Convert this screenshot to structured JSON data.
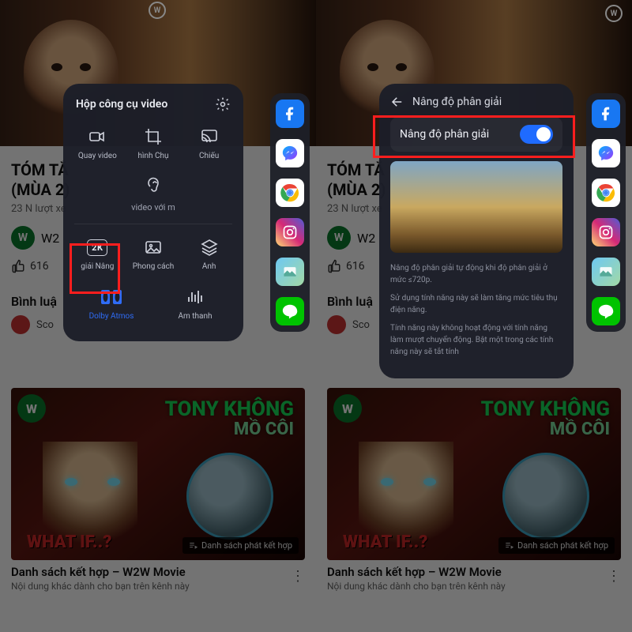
{
  "studio_badge": "W",
  "video": {
    "title_line1": "TÓM TẮ",
    "title_line2": "(MÙA 2)",
    "views": "23 N lượt xe",
    "channel_initial": "W",
    "channel_name": "W2",
    "like_count": "616",
    "comments_label": "Bình luậ",
    "commenter_name": "Sco"
  },
  "card": {
    "badge": "W",
    "headline_top": "TONY KHÔNG",
    "headline_bottom": "MỒ CÔI",
    "whatif": "WHAT IF..?",
    "playlist_tag": "Danh sách phát kết hợp",
    "title": "Danh sách kết hợp – W2W Movie",
    "subtitle": "Nội dung khác dành cho bạn trên kênh này"
  },
  "sidebar_apps": [
    "facebook",
    "messenger",
    "chrome",
    "instagram",
    "gallery",
    "line"
  ],
  "toolbox": {
    "title": "Hộp công cụ video",
    "tools_row1": [
      {
        "icon": "camcorder",
        "label": "Quay video"
      },
      {
        "icon": "crop",
        "label": "hình   Chụ"
      },
      {
        "icon": "cast",
        "label": "Chiếu"
      }
    ],
    "tools_row2_label": "video với m",
    "tools_row3": [
      {
        "icon": "2k",
        "label": "giải    Nâng"
      },
      {
        "icon": "image",
        "label": "Phong cách"
      },
      {
        "icon": "layers",
        "label": "Ảnh"
      }
    ],
    "tools_row4": [
      {
        "icon": "dolby",
        "label": "Dolby Atmos"
      },
      {
        "icon": "equalizer",
        "label": "Âm thanh"
      }
    ]
  },
  "resolution": {
    "header": "Nâng độ phân giải",
    "toggle_label": "Nâng độ phân giải",
    "toggle_on": true,
    "desc1": "Nâng độ phân giải tự động khi độ phân giải ở mức ≤720p.",
    "desc2": "Sử dụng tính năng này sẽ làm tăng mức tiêu thụ điện năng.",
    "desc3": "Tính năng này không hoạt động với tính năng làm mượt chuyển động. Bật một trong các tính năng này sẽ tắt tính"
  },
  "colors": {
    "accent_blue": "#1f6bff",
    "highlight_red": "#ff1e1e"
  }
}
